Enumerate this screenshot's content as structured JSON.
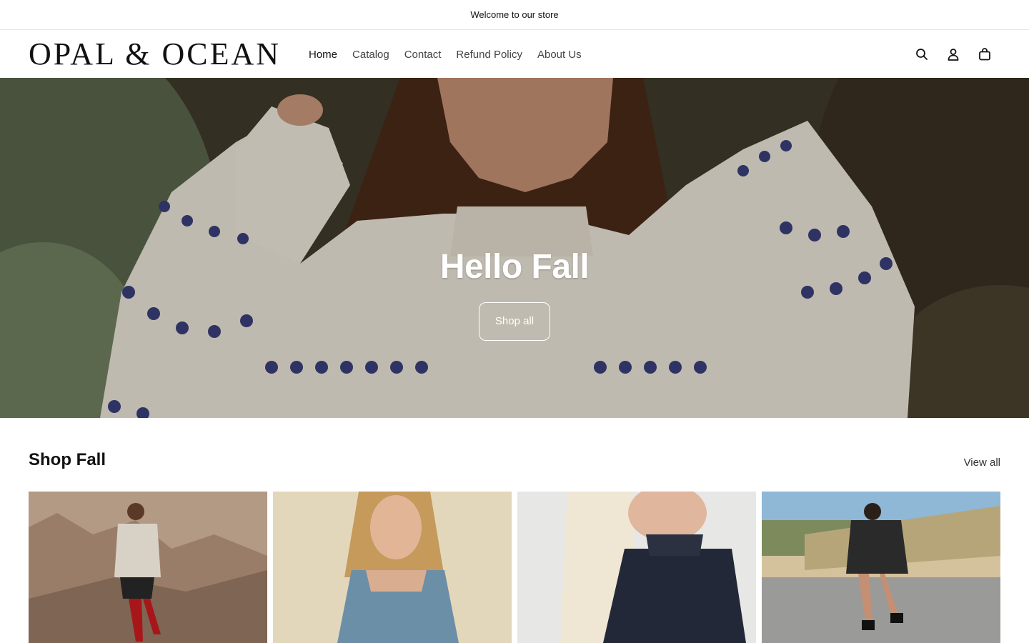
{
  "announcement": {
    "text": "Welcome to our store"
  },
  "header": {
    "logo_text": "OPAL & OCEAN",
    "nav": [
      {
        "label": "Home",
        "active": true
      },
      {
        "label": "Catalog"
      },
      {
        "label": "Contact"
      },
      {
        "label": "Refund Policy"
      },
      {
        "label": "About Us"
      }
    ],
    "icons": [
      "search-icon",
      "account-icon",
      "cart-icon"
    ]
  },
  "hero": {
    "title": "Hello Fall",
    "button_label": "Shop all"
  },
  "collection": {
    "title": "Shop Fall",
    "view_all_label": "View all",
    "products": [
      {
        "image": "woman-on-rocks-red-boots"
      },
      {
        "image": "woman-denim-top"
      },
      {
        "image": "woman-lace-top"
      },
      {
        "image": "woman-california-sweatshirt"
      }
    ]
  }
}
